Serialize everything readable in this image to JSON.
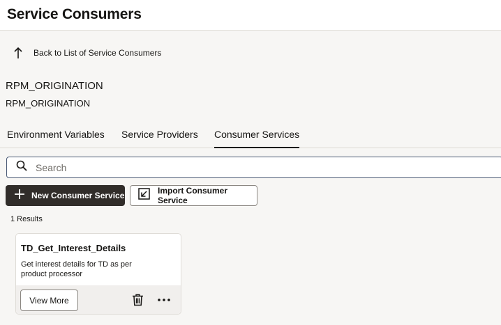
{
  "header": {
    "title": "Service Consumers"
  },
  "back": {
    "label": "Back to List of Service Consumers"
  },
  "entity": {
    "name": "RPM_ORIGINATION",
    "subtitle": "RPM_ORIGINATION"
  },
  "tabs": [
    {
      "label": "Environment Variables",
      "active": false
    },
    {
      "label": "Service Providers",
      "active": false
    },
    {
      "label": "Consumer Services",
      "active": true
    }
  ],
  "search": {
    "placeholder": "Search",
    "value": ""
  },
  "actions": {
    "new_label": "New Consumer Service",
    "import_label": "Import Consumer Service"
  },
  "results": {
    "count_text": "1 Results"
  },
  "cards": [
    {
      "title": "TD_Get_Interest_Details",
      "description": "Get interest details for TD as per product processor",
      "view_label": "View More"
    }
  ],
  "icons": {
    "back": "arrow-up-icon",
    "search": "search-icon",
    "new": "plus-icon",
    "import": "import-icon",
    "delete": "trash-icon",
    "more": "more-horizontal-icon"
  },
  "colors": {
    "primary_button": "#312d2a",
    "search_border": "#4a5a75",
    "background": "#f7f6f4"
  }
}
